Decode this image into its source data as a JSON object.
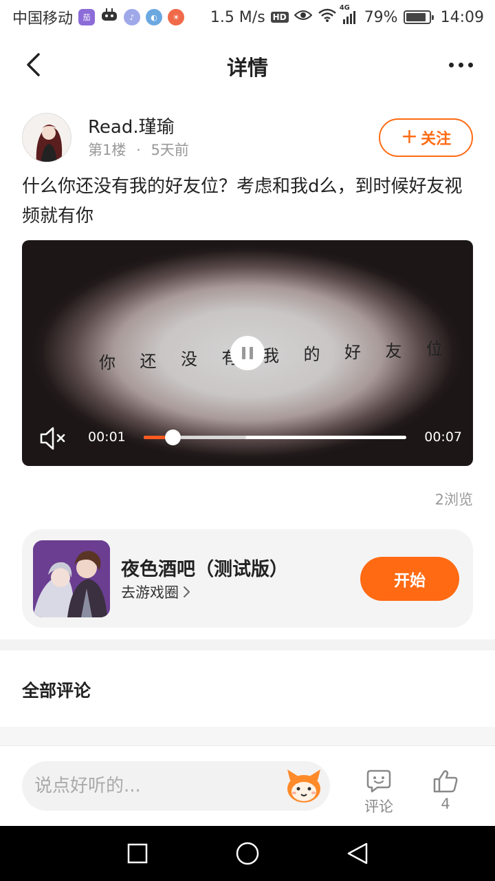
{
  "status_bar": {
    "carrier": "中国移动",
    "net_speed": "1.5 M/s",
    "hd": "HD",
    "network_type": "4G",
    "battery": "79%",
    "time": "14:09",
    "icons": [
      "app-badge-icon",
      "game-controller-icon",
      "music-icon",
      "browser-icon",
      "app-icon",
      "eye-icon",
      "wifi-icon",
      "signal-icon",
      "battery-icon"
    ]
  },
  "header": {
    "title": "详情"
  },
  "post": {
    "author": "Read.瑾瑜",
    "floor": "第1楼",
    "separator": "·",
    "time_ago": "5天前",
    "follow_label": "关注",
    "text": "什么你还没有我的好友位？考虑和我d么，到时候好友视频就有你"
  },
  "video": {
    "caption_chars": [
      "你",
      "还",
      "没",
      "有",
      "我",
      "的",
      "好",
      "友",
      "位"
    ],
    "current_time": "00:01",
    "total_time": "00:07",
    "progress": 0.11,
    "buffered": 0.39,
    "state": "playing",
    "muted": true
  },
  "views": "2浏览",
  "game_card": {
    "name": "夜色酒吧（测试版）",
    "link_label": "去游戏圈",
    "start_label": "开始"
  },
  "comments": {
    "heading": "全部评论"
  },
  "bottom_bar": {
    "input_placeholder": "说点好听的...",
    "comment_label": "评论",
    "like_count": "4"
  },
  "colors": {
    "accent": "#ff6a13",
    "progress": "#ff5a1f",
    "text_muted": "#999999"
  }
}
